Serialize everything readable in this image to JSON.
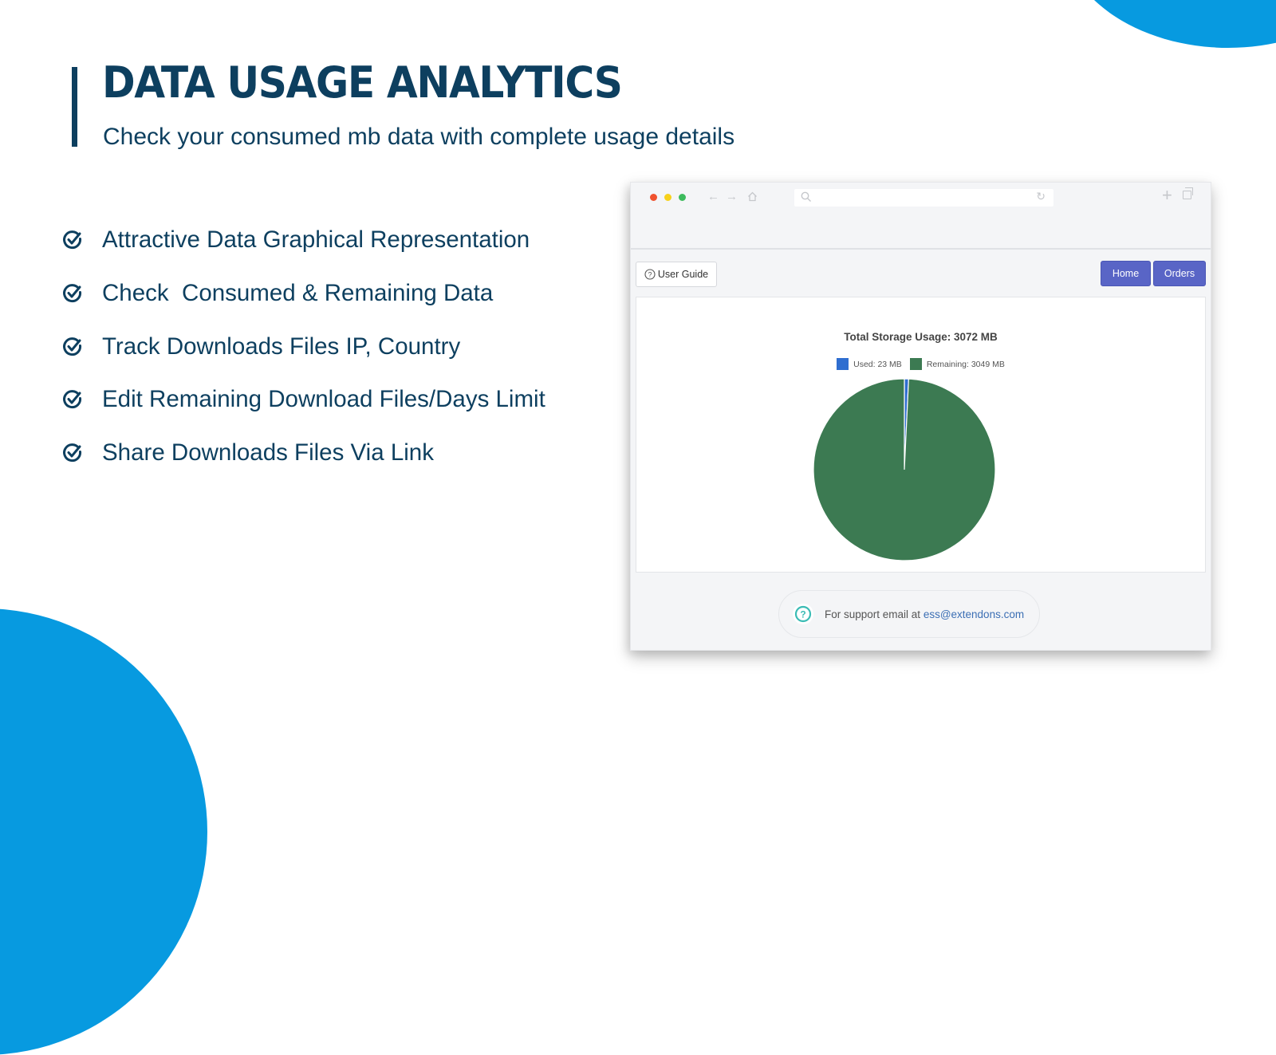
{
  "hero": {
    "title": "DATA USAGE ANALYTICS",
    "subtitle": "Check your consumed mb data with complete usage details"
  },
  "features": [
    {
      "icon": "check-circle-icon",
      "label": "Attractive Data Graphical Representation"
    },
    {
      "icon": "check-circle-icon",
      "label": "Check  Consumed & Remaining Data"
    },
    {
      "icon": "check-circle-icon",
      "label": "Track Downloads Files IP, Country"
    },
    {
      "icon": "check-circle-icon",
      "label": "Edit Remaining Download Files/Days Limit"
    },
    {
      "icon": "check-circle-icon",
      "label": "Share Downloads Files Via Link"
    }
  ],
  "colors": {
    "brand_navy": "#0d3f5f",
    "brand_blue": "#079ae0",
    "button_primary": "#5965c6",
    "used": "#2f6ed0",
    "remaining": "#3c7a52",
    "support_icon": "#3bbcb5",
    "link": "#3c6fb4"
  },
  "browser": {
    "window_controls": [
      "close",
      "minimize",
      "maximize"
    ],
    "nav_icons": [
      "back-arrow-icon",
      "forward-arrow-icon",
      "home-icon"
    ],
    "address_bar": {
      "value": "",
      "icons": [
        "search-icon",
        "reload-icon"
      ]
    },
    "right_icons": [
      "new-tab-icon",
      "tabs-icon"
    ]
  },
  "toolbar": {
    "user_guide_label": "User Guide",
    "home_label": "Home",
    "orders_label": "Orders"
  },
  "chart_data": {
    "type": "pie",
    "title": "Total Storage Usage: 3072 MB",
    "total_mb": 3072,
    "unit": "MB",
    "legend_placement": "top",
    "slices": [
      {
        "name": "Used",
        "value": 23,
        "legend_label": "Used: 23 MB",
        "color": "#2f6ed0"
      },
      {
        "name": "Remaining",
        "value": 3049,
        "legend_label": "Remaining: 3049 MB",
        "color": "#3c7a52"
      }
    ]
  },
  "support": {
    "text": "For support email at ",
    "email": "ess@extendons.com"
  }
}
